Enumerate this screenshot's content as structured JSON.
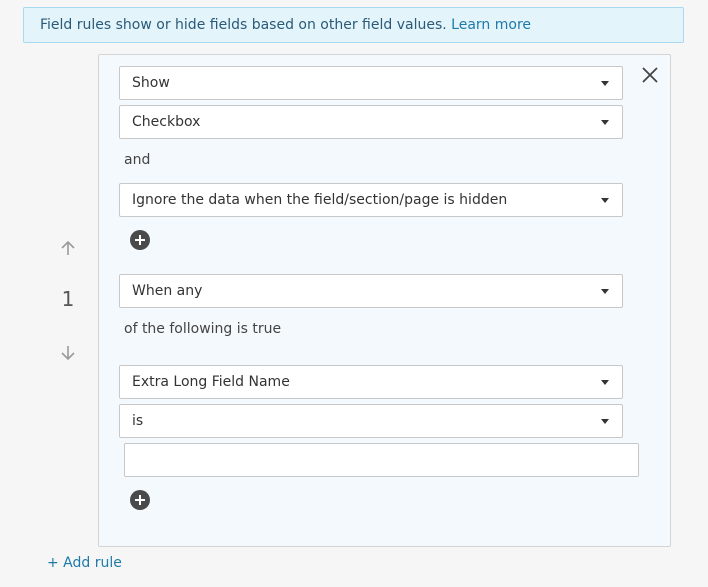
{
  "banner": {
    "text": "Field rules show or hide fields based on other field values. ",
    "link_label": "Learn more"
  },
  "rule": {
    "number": "1",
    "action_select": "Show",
    "field_select": "Checkbox",
    "and_label": "and",
    "hidden_data_select": "Ignore the data when the field/section/page is hidden",
    "match_select": "When any",
    "following_label": "of the following is true",
    "condition": {
      "field_select": "Extra Long Field Name",
      "operator_select": "is",
      "value": ""
    }
  },
  "footer": {
    "add_rule_label": "+ Add rule"
  },
  "icons": {
    "move_up": "arrow-up-icon",
    "move_down": "arrow-down-icon",
    "close": "close-icon",
    "add": "plus-circle-icon",
    "dropdown": "caret-down-icon"
  },
  "colors": {
    "link": "#1e7aa8",
    "banner_bg": "#e3f4fb",
    "card_bg": "#f4f9fd"
  }
}
